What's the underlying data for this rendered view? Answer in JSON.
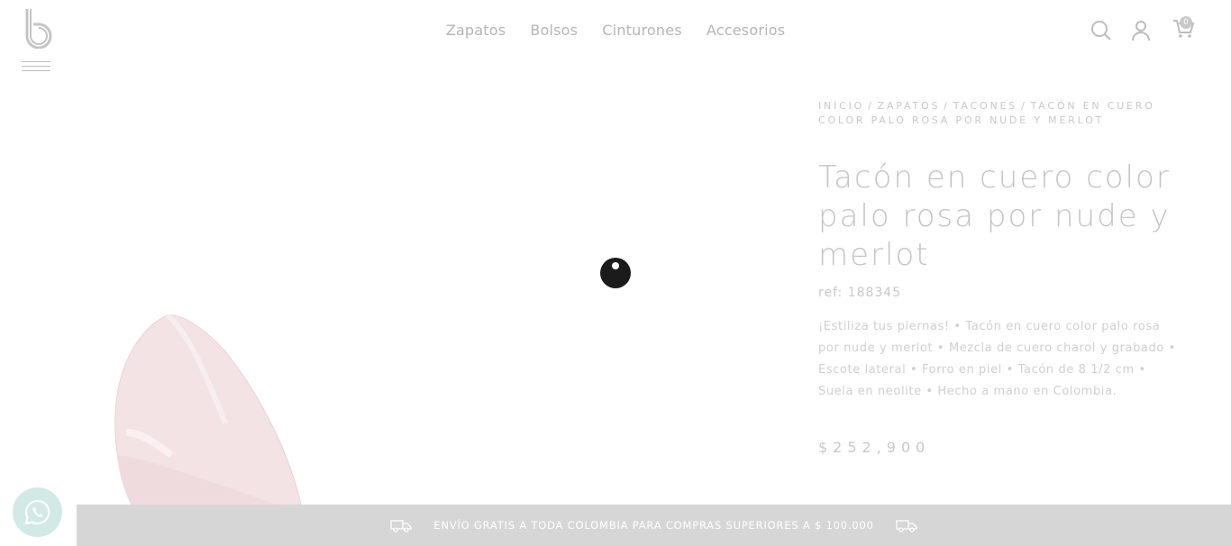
{
  "header": {
    "nav": [
      {
        "label": "Zapatos"
      },
      {
        "label": "Bolsos"
      },
      {
        "label": "Cinturones"
      },
      {
        "label": "Accesorios"
      }
    ],
    "cart_count": "0"
  },
  "product": {
    "breadcrumb": [
      "INICIO",
      "ZAPATOS",
      "TACONES",
      "TACÓN EN CUERO COLOR PALO ROSA POR NUDE Y MERLOT"
    ],
    "breadcrumb_separator": "/",
    "title": "Tacón en cuero color palo rosa por nude y merlot",
    "ref": "ref: 188345",
    "description": "¡Estiliza tus piernas! • Tacón en cuero color palo rosa por nude y merlot • Mezcla de cuero charol y grabado • Escote lateral • Forro en piel • Tacón de 8 1/2 cm • Suela en neolite • Hecho a mano en Colombia.",
    "price": "$252,900"
  },
  "shipping_bar": {
    "text": "ENVÍO GRATIS A TODA COLOMBIA PARA COMPRAS SUPERIORES A $ 100.000"
  },
  "icons": {
    "logo": "brand-b-logo",
    "menu": "hamburger-menu-icon",
    "search": "search-icon",
    "user": "user-icon",
    "cart": "cart-icon",
    "loader": "loading-spinner-icon",
    "whatsapp": "whatsapp-icon",
    "truck": "truck-icon"
  },
  "colors": {
    "nav_text": "#b5b5b5",
    "faded_text": "#c8c8c8",
    "shipping_bar": "#d6d6d6",
    "whatsapp_bg": "#d2e9e6",
    "shoe_pink": "#f1dfe2"
  }
}
